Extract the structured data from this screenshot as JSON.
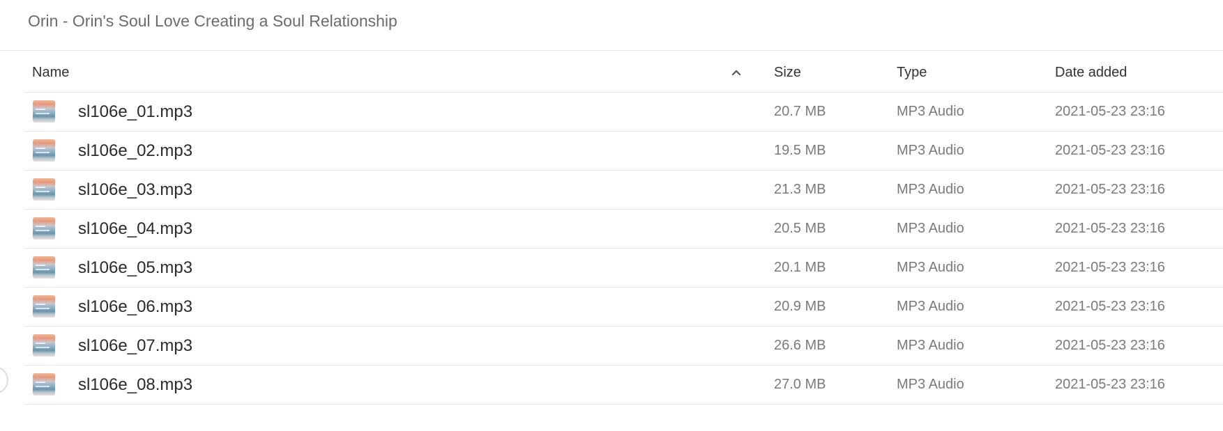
{
  "folder": {
    "title": "Orin - Orin's Soul Love Creating a Soul Relationship"
  },
  "columns": {
    "name": "Name",
    "size": "Size",
    "type": "Type",
    "date": "Date added",
    "sort_icon": "chevron-up-icon"
  },
  "files": [
    {
      "name": "sl106e_01.mp3",
      "size": "20.7 MB",
      "type": "MP3 Audio",
      "date": "2021-05-23 23:16"
    },
    {
      "name": "sl106e_02.mp3",
      "size": "19.5 MB",
      "type": "MP3 Audio",
      "date": "2021-05-23 23:16"
    },
    {
      "name": "sl106e_03.mp3",
      "size": "21.3 MB",
      "type": "MP3 Audio",
      "date": "2021-05-23 23:16"
    },
    {
      "name": "sl106e_04.mp3",
      "size": "20.5 MB",
      "type": "MP3 Audio",
      "date": "2021-05-23 23:16"
    },
    {
      "name": "sl106e_05.mp3",
      "size": "20.1 MB",
      "type": "MP3 Audio",
      "date": "2021-05-23 23:16"
    },
    {
      "name": "sl106e_06.mp3",
      "size": "20.9 MB",
      "type": "MP3 Audio",
      "date": "2021-05-23 23:16"
    },
    {
      "name": "sl106e_07.mp3",
      "size": "26.6 MB",
      "type": "MP3 Audio",
      "date": "2021-05-23 23:16"
    },
    {
      "name": "sl106e_08.mp3",
      "size": "27.0 MB",
      "type": "MP3 Audio",
      "date": "2021-05-23 23:16"
    }
  ],
  "colors": {
    "title_text": "#6b6b6b",
    "header_text": "#333333",
    "name_text": "#2b2b2b",
    "meta_text": "#7a7a7a",
    "divider": "#e6e6e6"
  }
}
